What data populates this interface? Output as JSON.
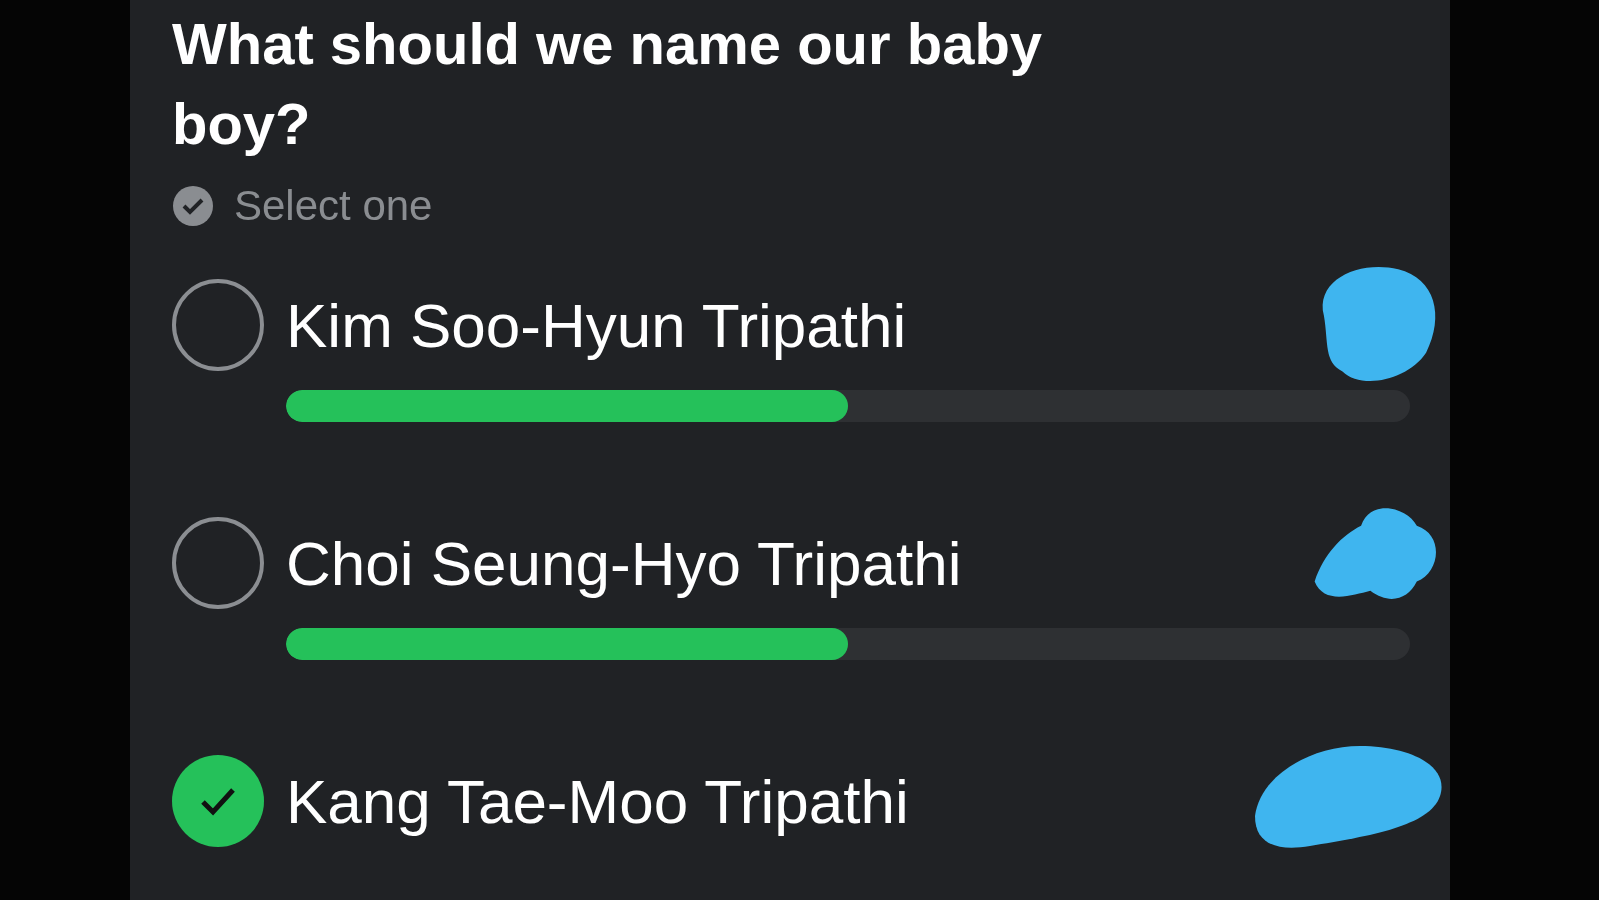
{
  "poll": {
    "question": "What should we name our baby boy?",
    "hint": "Select one",
    "options": [
      {
        "label": "Kim Soo-Hyun Tripathi",
        "selected": false,
        "level": 0.5
      },
      {
        "label": "Choi Seung-Hyo Tripathi",
        "selected": false,
        "level": 0.5
      },
      {
        "label": "Kang Tae-Moo Tripathi",
        "selected": true
      }
    ]
  }
}
